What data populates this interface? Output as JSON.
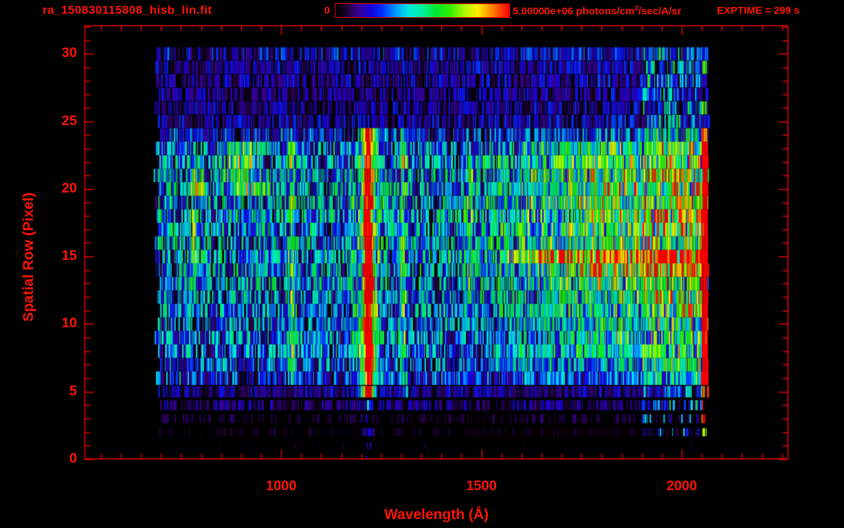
{
  "header": {
    "title": "ra_150830115808_hisb_lin.fit",
    "exptime": "EXPTIME = 299 s",
    "colorbar": {
      "min_label": "0",
      "max_label": "5.00000e+06",
      "units_prefix": " photons/cm",
      "units_sup": "2",
      "units_suffix": "/sec/A/sr"
    }
  },
  "colors": {
    "text": "#ff1505",
    "line": "#f20000",
    "background": "#000000"
  },
  "chart_data": {
    "type": "heatmap",
    "title": "ra_150830115808_hisb_lin.fit",
    "xlabel": "Wavelength (Å)",
    "ylabel": "Spatial Row (Pixel)",
    "xlim": [
      509,
      2266
    ],
    "ylim": [
      0,
      32.1
    ],
    "x_ticks_major": [
      1000,
      1500,
      2000
    ],
    "x_tick_minor_step": 50,
    "y_ticks_major": [
      0,
      5,
      10,
      15,
      20,
      25,
      30
    ],
    "y_tick_minor_step": 1,
    "exposure_time_s": 299,
    "colorbar": {
      "range": [
        0,
        5000000
      ],
      "units": "photons/cm^2/sec/A/sr",
      "stops": [
        [
          0.0,
          "#000000"
        ],
        [
          0.06,
          "#1c0030"
        ],
        [
          0.13,
          "#3a0090"
        ],
        [
          0.2,
          "#1500d8"
        ],
        [
          0.27,
          "#0030ff"
        ],
        [
          0.35,
          "#00a0ff"
        ],
        [
          0.42,
          "#00e8e0"
        ],
        [
          0.5,
          "#00f0a0"
        ],
        [
          0.58,
          "#00e830"
        ],
        [
          0.66,
          "#30f000"
        ],
        [
          0.74,
          "#a8f800"
        ],
        [
          0.82,
          "#fff000"
        ],
        [
          0.88,
          "#ffa000"
        ],
        [
          0.94,
          "#ff5000"
        ],
        [
          1.0,
          "#ff0000"
        ]
      ]
    },
    "data_extent": {
      "wavelength": [
        680,
        2065
      ],
      "rows": [
        0,
        30
      ]
    },
    "row_base_intensity": [
      0.01,
      0.02,
      0.05,
      0.07,
      0.12,
      0.14,
      0.22,
      0.26,
      0.3,
      0.3,
      0.28,
      0.3,
      0.3,
      0.32,
      0.33,
      0.34,
      0.33,
      0.33,
      0.34,
      0.34,
      0.33,
      0.33,
      0.32,
      0.3,
      0.22,
      0.15,
      0.14,
      0.13,
      0.14,
      0.15,
      0.18
    ],
    "row_draw_probability": [
      0.04,
      0.08,
      0.3,
      0.45,
      0.8,
      0.95,
      1,
      1,
      1,
      1,
      1,
      1,
      1,
      1,
      1,
      1,
      1,
      1,
      1,
      1,
      1,
      1,
      1,
      1,
      0.97,
      0.93,
      0.9,
      0.9,
      0.9,
      0.92,
      0.95
    ],
    "row_band_fill": [
      0.5,
      0.55,
      0.6,
      0.65,
      0.75,
      0.85,
      1,
      1,
      1,
      1,
      1,
      1,
      1,
      1,
      1,
      1,
      1,
      1,
      1,
      1,
      1,
      1,
      1,
      1,
      1,
      0.97,
      0.97,
      0.97,
      0.97,
      0.97,
      0.97
    ],
    "black_stripe_probability": 0.1,
    "noise_multiplier": {
      "min": 0.15,
      "max": 1.85
    },
    "continuum": {
      "start_wavelength": 1380,
      "full_wavelength": 1800,
      "row_amplitude": [
        0,
        0,
        0,
        0,
        0,
        0,
        0.1,
        0.14,
        0.2,
        0.2,
        0.2,
        0.22,
        0.24,
        0.26,
        0.3,
        0.32,
        0.28,
        0.3,
        0.32,
        0.33,
        0.33,
        0.32,
        0.3,
        0.26,
        0.08,
        0.04,
        0.03,
        0.03,
        0.03,
        0.03,
        0.03
      ]
    },
    "features": [
      {
        "name": "emission-line-782",
        "kind": "line",
        "center": 782,
        "sigma": 5,
        "rows": [
          12,
          20
        ],
        "amplitude": 0.32
      },
      {
        "name": "cyan-blob-790",
        "kind": "line",
        "center": 790,
        "sigma": 20,
        "rows": [
          20,
          21
        ],
        "amplitude": 0.26
      },
      {
        "name": "green-blob-860-950",
        "kind": "line",
        "center": 905,
        "sigma": 33,
        "rows": [
          20,
          23
        ],
        "amplitude": 0.34
      },
      {
        "name": "lyman-beta-1026",
        "kind": "line",
        "center": 1026,
        "sigma": 7,
        "rows": [
          6,
          23
        ],
        "amplitude": 0.32
      },
      {
        "name": "lyman-alpha-1216-core",
        "kind": "line_rowjitter",
        "center": 1216,
        "sigma": 8,
        "rows": [
          5,
          24
        ],
        "amplitude": 0.85
      },
      {
        "name": "lyman-alpha-1216-wings",
        "kind": "line",
        "center": 1216,
        "sigma": 22,
        "rows": [
          5,
          24
        ],
        "amplitude": 0.32
      },
      {
        "name": "lyman-alpha-1216-bottom",
        "kind": "line",
        "center": 1216,
        "sigma": 10,
        "rows": [
          0,
          4
        ],
        "amplitude": 0.17
      },
      {
        "name": "oi-1304",
        "kind": "line",
        "center": 1304,
        "sigma": 7,
        "rows": [
          5,
          24
        ],
        "amplitude": 0.28
      },
      {
        "name": "emission-line-1470",
        "kind": "line",
        "center": 1470,
        "sigma": 6,
        "rows": [
          12,
          21
        ],
        "amplitude": 0.24
      },
      {
        "name": "bright-streak-row-15",
        "kind": "row_streak",
        "row": 15,
        "from": 1530,
        "to": 2062,
        "amplitude": 0.3
      },
      {
        "name": "bright-streak-row-14",
        "kind": "row_streak",
        "row": 14,
        "from": 1680,
        "to": 2062,
        "amplitude": 0.18
      },
      {
        "name": "right-edge-red-column",
        "kind": "edge_column",
        "center": 2056,
        "halfwidth": 8,
        "rows": [
          2,
          24
        ],
        "amplitude": 0.85
      },
      {
        "name": "right-edge-red-upper",
        "kind": "edge_column_sparse",
        "center": 2056,
        "halfwidth": 6,
        "rows": [
          25,
          30
        ],
        "amplitude": 0.6,
        "probability": 0.4
      },
      {
        "name": "right-speckle-1900-2050",
        "kind": "speckle_band",
        "from": 1900,
        "to": 2048,
        "rows": [
          2,
          30
        ],
        "amplitude": 0.4,
        "probability": 0.5
      }
    ]
  }
}
